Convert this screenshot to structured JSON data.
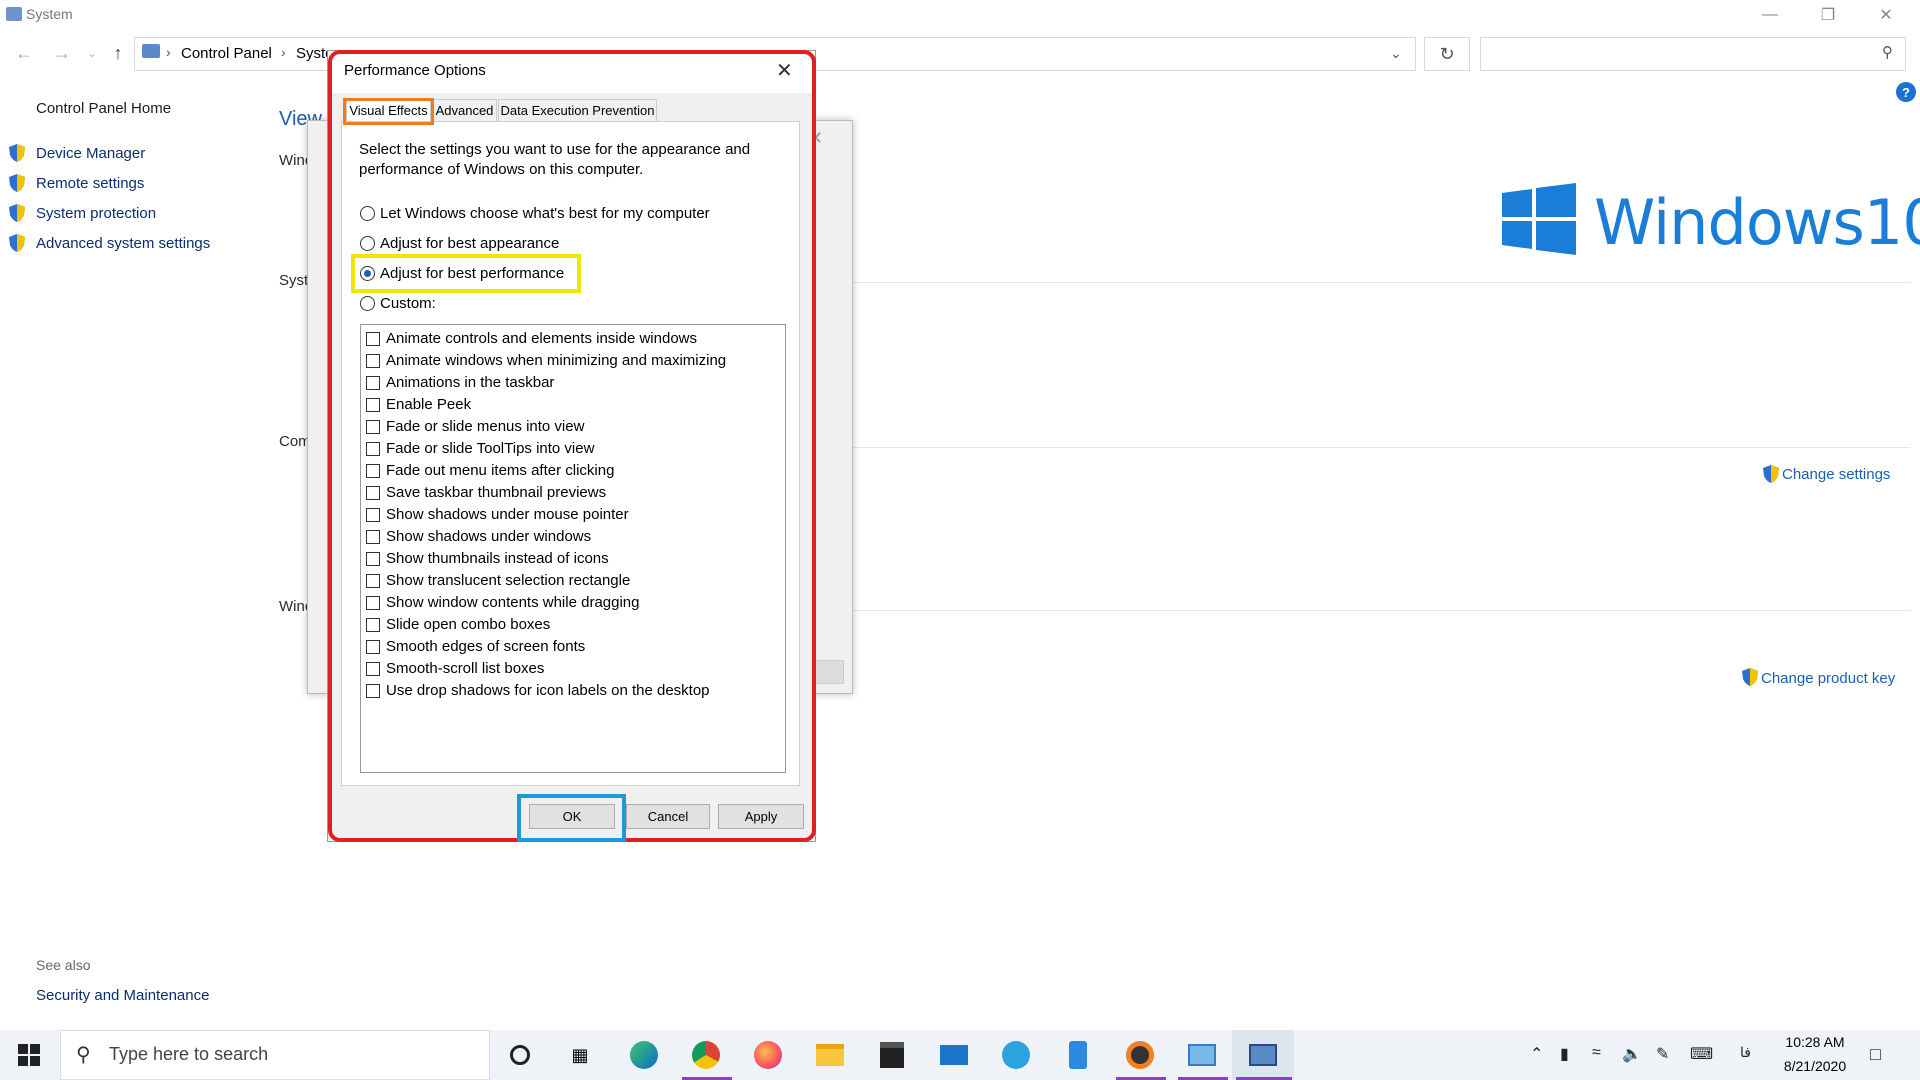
{
  "window": {
    "title": "System"
  },
  "nav": {
    "breadcrumb": [
      "Control Panel",
      "Syste"
    ],
    "search_placeholder": ""
  },
  "left_pane": {
    "home": "Control Panel Home",
    "links": [
      "Device Manager",
      "Remote settings",
      "System protection",
      "Advanced system settings"
    ],
    "see_also_heading": "See also",
    "see_also_links": [
      "Security and Maintenance"
    ]
  },
  "background": {
    "view_heading": "View",
    "section_labels": [
      "Winc",
      "Syste",
      "Com",
      "Winc"
    ],
    "change_settings": "Change settings",
    "change_product_key": "Change product key",
    "logo_text": "Windows10"
  },
  "dialog": {
    "title": "Performance Options",
    "tabs": [
      "Visual Effects",
      "Advanced",
      "Data Execution Prevention"
    ],
    "active_tab": "Visual Effects",
    "description": "Select the settings you want to use for the appearance and performance of Windows on this computer.",
    "options": [
      {
        "label": "Let Windows choose what's best for my computer",
        "selected": false
      },
      {
        "label": "Adjust for best appearance",
        "selected": false
      },
      {
        "label": "Adjust for best performance",
        "selected": true
      },
      {
        "label": "Custom:",
        "selected": false
      }
    ],
    "effects": [
      {
        "label": "Animate controls and elements inside windows",
        "checked": false
      },
      {
        "label": "Animate windows when minimizing and maximizing",
        "checked": false
      },
      {
        "label": "Animations in the taskbar",
        "checked": false
      },
      {
        "label": "Enable Peek",
        "checked": false
      },
      {
        "label": "Fade or slide menus into view",
        "checked": false
      },
      {
        "label": "Fade or slide ToolTips into view",
        "checked": false
      },
      {
        "label": "Fade out menu items after clicking",
        "checked": false
      },
      {
        "label": "Save taskbar thumbnail previews",
        "checked": false
      },
      {
        "label": "Show shadows under mouse pointer",
        "checked": false
      },
      {
        "label": "Show shadows under windows",
        "checked": false
      },
      {
        "label": "Show thumbnails instead of icons",
        "checked": false
      },
      {
        "label": "Show translucent selection rectangle",
        "checked": false
      },
      {
        "label": "Show window contents while dragging",
        "checked": false
      },
      {
        "label": "Slide open combo boxes",
        "checked": false
      },
      {
        "label": "Smooth edges of screen fonts",
        "checked": false
      },
      {
        "label": "Smooth-scroll list boxes",
        "checked": false
      },
      {
        "label": "Use drop shadows for icon labels on the desktop",
        "checked": false
      }
    ],
    "buttons": {
      "ok": "OK",
      "cancel": "Cancel",
      "apply": "Apply"
    }
  },
  "taskbar": {
    "search_placeholder": "Type here to search",
    "time": "10:28 AM",
    "date": "8/21/2020",
    "lang": "فا"
  },
  "colors": {
    "highlight_red": "#e02020",
    "highlight_orange": "#f07a20",
    "highlight_yellow": "#f5e400",
    "highlight_blue": "#1a9ad8",
    "accent": "#1a7ed8"
  }
}
